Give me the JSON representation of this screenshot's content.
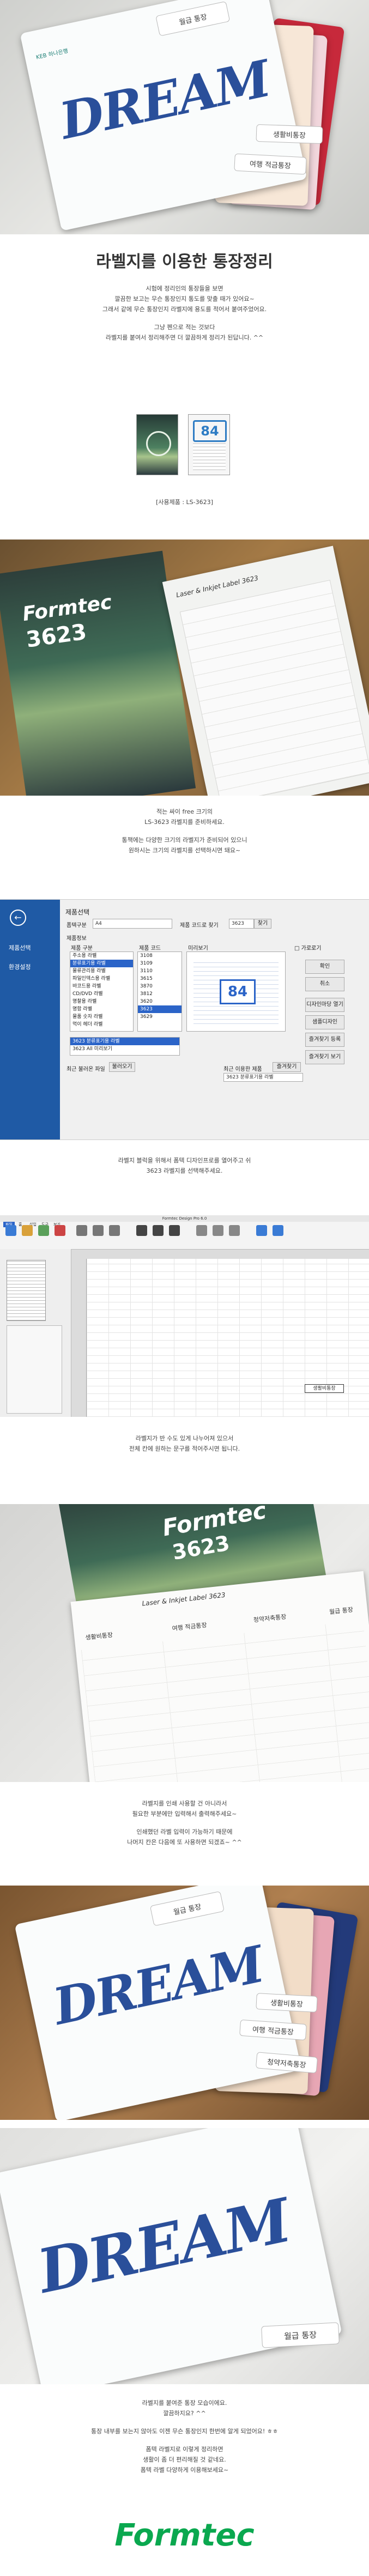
{
  "hero_card": {
    "word": "DREAM",
    "brand_small": "KEB 하나은행",
    "labels": [
      "월급 통장",
      "생활비통장",
      "여행 적금통장"
    ]
  },
  "title": "라벨지를 이용한 통장정리",
  "intro_lines": [
    "시험에 정리인의 통장들을 보면",
    "깔끔한 보고는 무슨 통장인지 통도를 맞출 때가 있어요~",
    "그래서 같에 무슨 통장인지 라벨지에 용도를 적어서 붙여주었어요.",
    "",
    "그냥 펜으로 적는 것보다",
    "라벨지를 붙여서 정리해주면 더 깔끔하게 정리가 된답니다. ^^"
  ],
  "product": {
    "number": "84",
    "caption": "[사용제품 : LS-3623]"
  },
  "photo_a": {
    "brand": "Formtec",
    "number": "3623",
    "sheet_title": "Laser & Inkjet Label 3623"
  },
  "caption_a": [
    "적는 싸이 free 크기의",
    "LS-3623 라벨지를 준비하세요.",
    "",
    "통책에는 다양한 크기의 라벨지가 준비되어 있으니",
    "원하시는 크기의 라벨지를 선택하시면 돼요~"
  ],
  "dialog": {
    "nav": [
      "제품선택",
      "환경설정"
    ],
    "header": "제품선택",
    "brand_label": "폼텍구분",
    "brand_value": "A4",
    "search_label": "제품 코드로 찾기",
    "search_value": "3623",
    "search_btn": "찾기",
    "group_label": "제품정보",
    "col1": "제품 구분",
    "col2": "제품 코드",
    "col3": "미리보기",
    "categories": [
      "주소용 라벨",
      "분류표기용 라벨",
      "물류관리용 라벨",
      "파일인덱스용 라벨",
      "바코드용 라벨",
      "CD/DVD 라벨",
      "명찰용 라벨",
      "명함 라벨",
      "물품 숫자 라벨",
      "먹이 헤더 라벨"
    ],
    "codes": [
      "3108",
      "3109",
      "3110",
      "3615",
      "3870",
      "3812",
      "3620",
      "3623",
      "3629"
    ],
    "preview_number": "84",
    "reverse_check": "가로로기",
    "buttons": [
      "확인",
      "취소",
      "디자인마당 열기",
      "샘플디자인",
      "즐겨찾기 등록"
    ],
    "favorites_btn": "즐겨찾기 보기",
    "result_rows": [
      "3623  분류표기용 라벨",
      "3623  All 미리보기"
    ],
    "recent_label": "최근 불러온 파일",
    "recent_btn": "불러오기",
    "recent_right": "최근 이용한 제품",
    "recent_right_row": "3623 분류표기용 라벨",
    "recent_right_btn": "즐겨찾기"
  },
  "caption_b": [
    "라벨지 블럭을 위해서 폼텍 디자인프로를 열어주고 쉬",
    "3623 라벨지를 선택해주세요."
  ],
  "editor": {
    "title": "Formtec Design Pro 6.0",
    "tabs": [
      "파일",
      "홈",
      "삽입",
      "도구",
      "보기"
    ],
    "label_text": "생활비통장"
  },
  "caption_c": [
    "라벨지가 반 수도 있게 나누어져 있으서",
    "전체 칸에 원하는 문구를 적어주시면 됩니다."
  ],
  "photo_b": {
    "brand": "Formtec",
    "number": "3623",
    "sheet_title": "Laser & Inkjet Label 3623",
    "labels": [
      "생활비통장",
      "여행 적금통장",
      "청약저축통장",
      "월급 통장"
    ]
  },
  "caption_d": [
    "라벨지를 인쇄 사용할 건 아니라서",
    "필요한 부분에만 입력해서 출력해주세요~",
    "",
    "인쇄했던 라벨 입력이 가능하기 때문에",
    "나머지 칸은 다음에 또 사용하면 되겠죠~ ^^"
  ],
  "photo_c": {
    "labels": [
      "월급 통장",
      "생활비통장",
      "여행 적금통장",
      "청약저축통장"
    ]
  },
  "photo_d": {
    "label": "월급 통장"
  },
  "caption_e": [
    "라벨지를 붙여준 통장 모습이에요.",
    "깔끔하지요? ^^",
    "",
    "통장 내부를 보는지 않아도 이젠 무슨 통장인지 한번에 알게 되었어요! ㅎㅎ",
    "",
    "폼텍 라벨지로 이렇게 정리하면",
    "생활이 좀 더 편리해질 것 같네요.",
    "폼텍 라벨 다양하게 이용해보세요~"
  ],
  "footer_logo": "Formtec"
}
